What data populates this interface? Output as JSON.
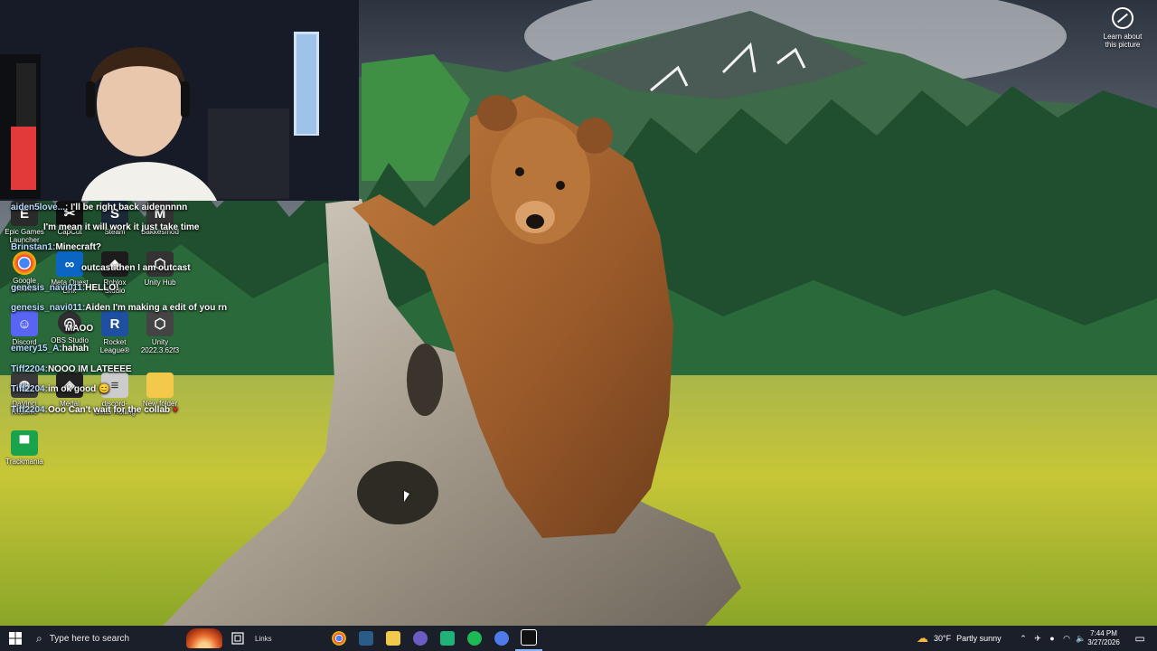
{
  "desktop": {
    "learn_label": "Learn about this picture",
    "icons": [
      {
        "label": "Epic Games Launcher",
        "icon": "epic-icon",
        "color": "#2a2a2a"
      },
      {
        "label": "CapCut",
        "icon": "capcut-icon",
        "color": "#111111"
      },
      {
        "label": "Steam",
        "icon": "steam-icon",
        "color": "#1b2838"
      },
      {
        "label": "Bakkesmod",
        "icon": "bakkesmod-icon",
        "color": "#333333"
      },
      {
        "label": "Google Chrome",
        "icon": "chrome-icon",
        "color": "#ffffff"
      },
      {
        "label": "Meta Quest Link",
        "icon": "meta-quest-icon",
        "color": "#0a66c2"
      },
      {
        "label": "Roblox Studio",
        "icon": "roblox-icon",
        "color": "#1c1c1c"
      },
      {
        "label": "Unity Hub",
        "icon": "unity-hub-icon",
        "color": "#333333"
      },
      {
        "label": "Discord",
        "icon": "discord-icon",
        "color": "#5865f2"
      },
      {
        "label": "OBS Studio",
        "icon": "obs-icon",
        "color": "#302e31"
      },
      {
        "label": "Rocket League®",
        "icon": "rocket-league-icon",
        "color": "#1e4fa0"
      },
      {
        "label": "Unity 2022.3.62f3",
        "icon": "unity-icon",
        "color": "#444444"
      },
      {
        "label": "DaVinci Resolve",
        "icon": "davinci-icon",
        "color": "#3a3a3a"
      },
      {
        "label": "Medal",
        "icon": "medal-icon",
        "color": "#222222"
      },
      {
        "label": "discord-ideas Rolling",
        "icon": "file-icon",
        "color": "#cccccc"
      },
      {
        "label": "New folder",
        "icon": "folder-icon",
        "color": "#f3c94b"
      },
      {
        "label": "Trackmania",
        "icon": "trackmania-icon",
        "color": "#1aa34a"
      }
    ]
  },
  "chat": [
    {
      "user": "aiden5love...",
      "msg": ": I'll be right back aidennnnn"
    },
    {
      "user": "",
      "msg": "I'm mean it will work it just take time"
    },
    {
      "user": "Brinstan1:",
      "msg": "Minecraft?"
    },
    {
      "user": "",
      "msg": "outcast then I am outcast"
    },
    {
      "user": "genesis_navi011:",
      "msg": "HELLO!"
    },
    {
      "user": "genesis_navi011:",
      "msg": "Aiden I'm making a edit of you rn"
    },
    {
      "user": "",
      "msg": "MAOO"
    },
    {
      "user": "emery15_A:",
      "msg": "hahah"
    },
    {
      "user": "Tiff2204:",
      "msg": "NOOO IM LATEEEE"
    },
    {
      "user": "Tiff2204:",
      "msg": "im ok good 😊"
    },
    {
      "user": "Tiff2204:",
      "msg": "Ooo Can't wait for the collab"
    }
  ],
  "taskbar": {
    "search_placeholder": "Type here to search",
    "links_label": "Links",
    "weather_temp": "30°F",
    "weather_desc": "Partly sunny",
    "time": "7:44 PM",
    "date": "3/27/2026",
    "apps": [
      {
        "name": "chrome-taskbar-icon",
        "color": "#e44134"
      },
      {
        "name": "steam-taskbar-icon",
        "color": "#2a5c8a"
      },
      {
        "name": "file-explorer-taskbar-icon",
        "color": "#f3c94b"
      },
      {
        "name": "obs-taskbar-icon",
        "color": "#6b5cc4"
      },
      {
        "name": "game-taskbar-icon",
        "color": "#1fb37a"
      },
      {
        "name": "spotify-taskbar-icon",
        "color": "#1db954"
      },
      {
        "name": "chrome-alt-taskbar-icon",
        "color": "#4e7be8"
      },
      {
        "name": "capcut-taskbar-icon",
        "color": "#111111"
      }
    ]
  }
}
